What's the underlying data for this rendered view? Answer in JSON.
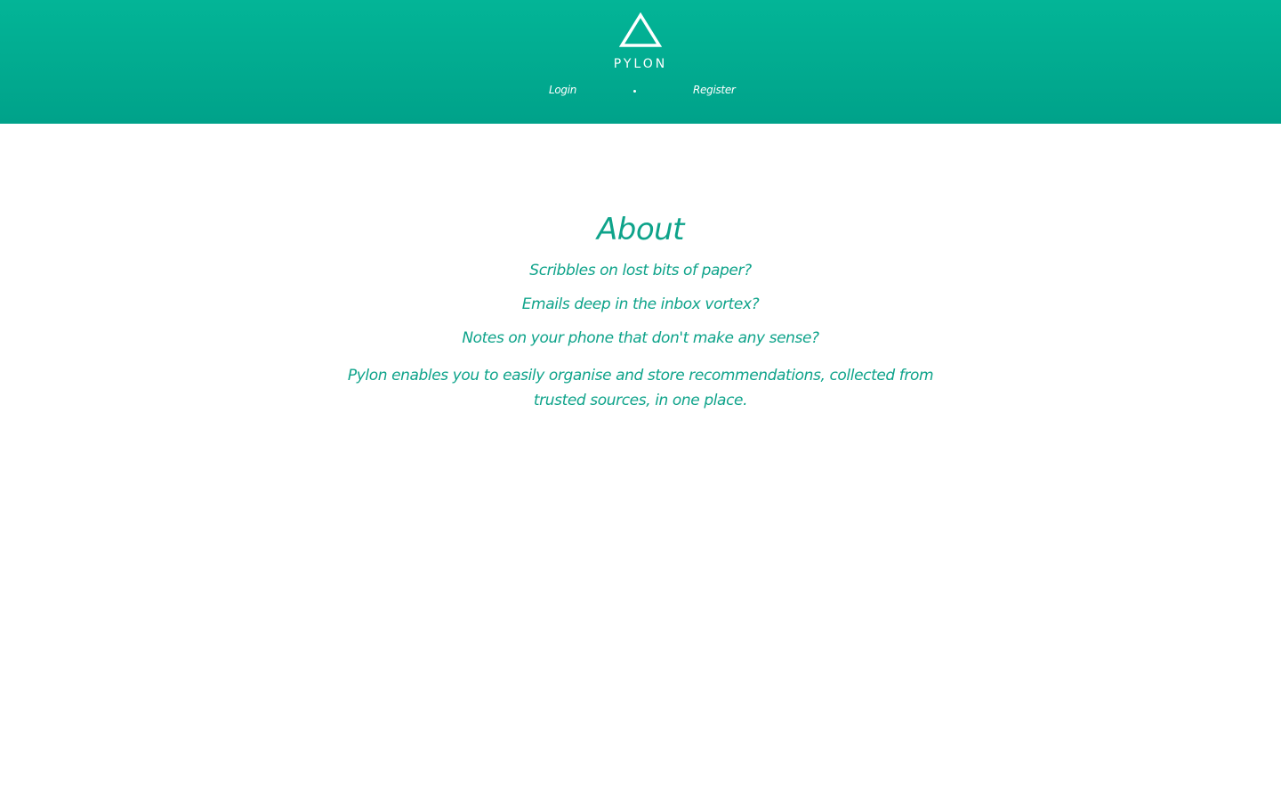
{
  "header": {
    "logo_icon": "triangle-outline-icon",
    "brand": "PYLON",
    "nav": {
      "login_label": "Login",
      "separator": "•",
      "register_label": "Register"
    },
    "colors": {
      "gradient_top": "#03b597",
      "gradient_bottom": "#00a28a",
      "text": "#ffffff"
    }
  },
  "about": {
    "title": "About",
    "lines": [
      "Scribbles on lost bits of paper?",
      "Emails deep in the inbox vortex?",
      "Notes on your phone that don't make any sense?",
      "Pylon enables you to easily organise and store recommendations, collected from trusted sources, in one place."
    ],
    "color": "#0ea38a"
  }
}
